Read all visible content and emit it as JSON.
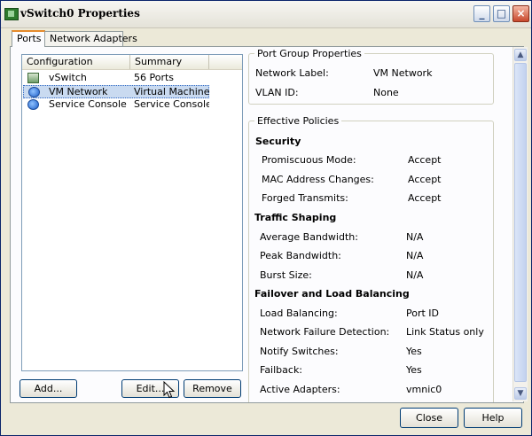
{
  "window": {
    "title": "vSwitch0 Properties"
  },
  "tabs": [
    {
      "label": "Ports",
      "active": true
    },
    {
      "label": "Network Adapters",
      "active": false
    }
  ],
  "list": {
    "columns": [
      "Configuration",
      "Summary"
    ],
    "rows": [
      {
        "icon": "vswitch-icon",
        "configuration": "vSwitch",
        "summary": "56 Ports",
        "selected": false
      },
      {
        "icon": "network-globe-icon",
        "configuration": "VM Network",
        "summary": "Virtual Machine ...",
        "selected": true
      },
      {
        "icon": "network-globe-icon",
        "configuration": "Service Console",
        "summary": "Service Console ...",
        "selected": false
      }
    ]
  },
  "buttons": {
    "add": "Add...",
    "edit": "Edit...",
    "remove": "Remove",
    "close": "Close",
    "help": "Help"
  },
  "port_group": {
    "legend": "Port Group Properties",
    "network_label": {
      "label": "Network Label:",
      "value": "VM Network"
    },
    "vlan_id": {
      "label": "VLAN ID:",
      "value": "None"
    }
  },
  "effective_policies": {
    "legend": "Effective Policies",
    "security": {
      "title": "Security",
      "promiscuous": {
        "label": "Promiscuous Mode:",
        "value": "Accept"
      },
      "mac_changes": {
        "label": "MAC Address Changes:",
        "value": "Accept"
      },
      "forged": {
        "label": "Forged Transmits:",
        "value": "Accept"
      }
    },
    "traffic_shaping": {
      "title": "Traffic Shaping",
      "avg_bw": {
        "label": "Average Bandwidth:",
        "value": "N/A"
      },
      "peak_bw": {
        "label": "Peak Bandwidth:",
        "value": "N/A"
      },
      "burst": {
        "label": "Burst Size:",
        "value": "N/A"
      }
    },
    "failover": {
      "title": "Failover and Load Balancing",
      "load_balancing": {
        "label": "Load Balancing:",
        "value": "Port ID"
      },
      "failure_detection": {
        "label": "Network Failure Detection:",
        "value": "Link Status only"
      },
      "notify": {
        "label": "Notify Switches:",
        "value": "Yes"
      },
      "failback": {
        "label": "Failback:",
        "value": "Yes"
      },
      "active_adapters": {
        "label": "Active Adapters:",
        "value": "vmnic0"
      }
    }
  },
  "scrollbar": {
    "up": "▲",
    "down": "▼"
  }
}
